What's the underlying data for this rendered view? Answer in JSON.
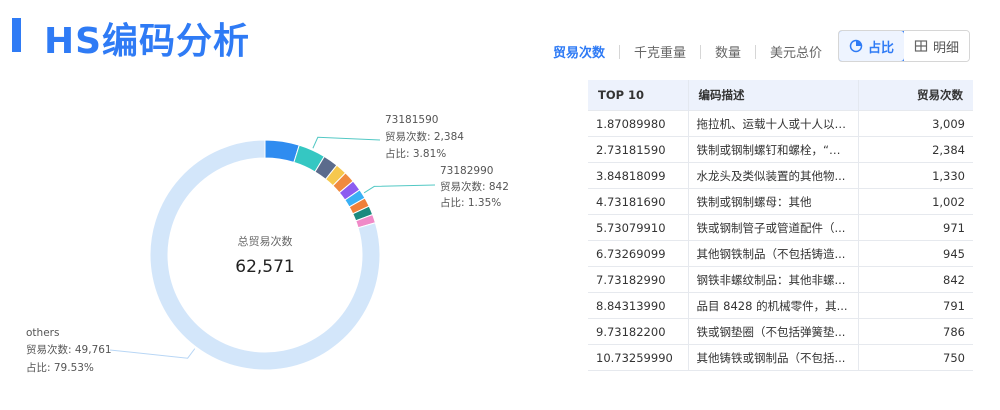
{
  "header": {
    "title": "HS编码分析"
  },
  "tabs": [
    {
      "label": "贸易次数",
      "active": true
    },
    {
      "label": "千克重量",
      "active": false
    },
    {
      "label": "数量",
      "active": false
    },
    {
      "label": "美元总价",
      "active": false
    }
  ],
  "view_toggle": {
    "pie_label": "占比",
    "detail_label": "明细",
    "active": "pie"
  },
  "chart_data": {
    "type": "pie",
    "center_label": "总贸易次数",
    "center_value": "62,571",
    "slices": [
      {
        "code": "87089980",
        "value": 3009,
        "color": "#2f8cf0"
      },
      {
        "code": "73181590",
        "value": 2384,
        "color": "#35c7c2"
      },
      {
        "code": "84818099",
        "value": 1330,
        "color": "#5b6b8c"
      },
      {
        "code": "73181690",
        "value": 1002,
        "color": "#f6c84d"
      },
      {
        "code": "73079910",
        "value": 971,
        "color": "#f08a3e"
      },
      {
        "code": "73269099",
        "value": 945,
        "color": "#8c5cf0"
      },
      {
        "code": "73182990",
        "value": 842,
        "color": "#3ab0f5"
      },
      {
        "code": "84313990",
        "value": 791,
        "color": "#f0803a"
      },
      {
        "code": "73182200",
        "value": 786,
        "color": "#1c8a7e"
      },
      {
        "code": "73259990",
        "value": 750,
        "color": "#f08ac8"
      },
      {
        "code": "others",
        "value": 49761,
        "color": "#d3e6fa"
      }
    ],
    "callouts": [
      {
        "code": "73181590",
        "count_line": "贸易次数: 2,384",
        "pct_line": "占比: 3.81%"
      },
      {
        "code": "73182990",
        "count_line": "贸易次数: 842",
        "pct_line": "占比: 1.35%"
      },
      {
        "code": "others",
        "count_line": "贸易次数: 49,761",
        "pct_line": "占比: 79.53%"
      }
    ]
  },
  "table": {
    "headers": [
      "TOP 10",
      "编码描述",
      "贸易次数"
    ],
    "rows": [
      [
        "1.87089980",
        "拖拉机、运载十人或十人以上的客运机动车辆等的其他零件",
        "3,009"
      ],
      [
        "2.73181590",
        "铁制或钢制螺钉和螺栓，“无...",
        "2,384"
      ],
      [
        "3.84818099",
        "水龙头及类似装置的其他物...",
        "1,330"
      ],
      [
        "4.73181690",
        "铁制或钢制螺母：其他",
        "1,002"
      ],
      [
        "5.73079910",
        "铁或钢制管子或管道配件（...",
        "971"
      ],
      [
        "6.73269099",
        "其他钢铁制品（不包括铸造...",
        "945"
      ],
      [
        "7.73182990",
        "钢铁非螺纹制品：其他非螺...",
        "842"
      ],
      [
        "8.84313990",
        "品目 8428 的机械零件，其...",
        "791"
      ],
      [
        "9.73182200",
        "铁或钢垫圈（不包括弹簧垫...",
        "786"
      ],
      [
        "10.73259990",
        "其他铸铁或钢制品（不包括...",
        "750"
      ]
    ]
  }
}
